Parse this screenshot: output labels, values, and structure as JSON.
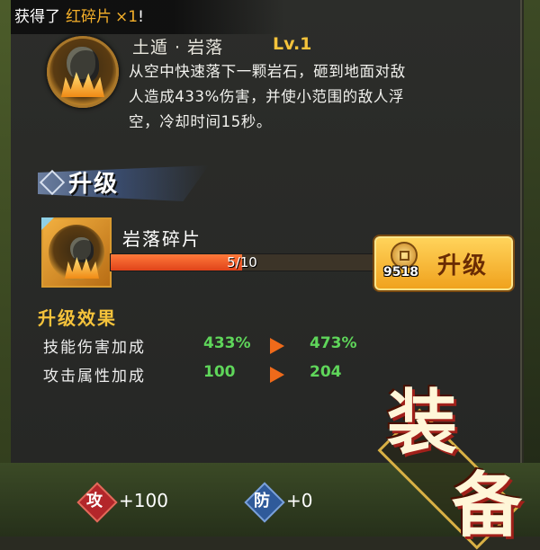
{
  "notification": {
    "prefix": "获得了",
    "item": "红碎片",
    "quantity": "×1",
    "suffix": "!"
  },
  "skill": {
    "name": "土遁 · 岩落",
    "level": "Lv.1",
    "description_lines": [
      "从空中快速落下一颗岩石，砸到地面对敌",
      "人造成433%伤害，并使小范围的敌人浮",
      "空，冷却时间15秒。"
    ]
  },
  "upgrade_section": {
    "title": "升级"
  },
  "fragment": {
    "name": "岩落碎片",
    "progress_text": "5/10",
    "progress_fraction": 0.5
  },
  "upgrade_button": {
    "label": "升级",
    "cost": "9518"
  },
  "effects": {
    "title": "升级效果",
    "rows": [
      {
        "label": "技能伤害加成",
        "from": "433%",
        "to": "473%"
      },
      {
        "label": "攻击属性加成",
        "from": "100",
        "to": "204"
      }
    ]
  },
  "stats": {
    "attack": {
      "char": "攻",
      "value": "+100",
      "color": "#b3262a"
    },
    "defense": {
      "char": "防",
      "value": "+0",
      "color": "#2f5a9a"
    }
  },
  "equip_banner": {
    "char1": "装",
    "char2": "备"
  },
  "colors": {
    "accent_gold": "#f5c33b",
    "value_green": "#5fd65a",
    "arrow_orange": "#ef6a1a",
    "progress_fill": "#e0431a"
  }
}
